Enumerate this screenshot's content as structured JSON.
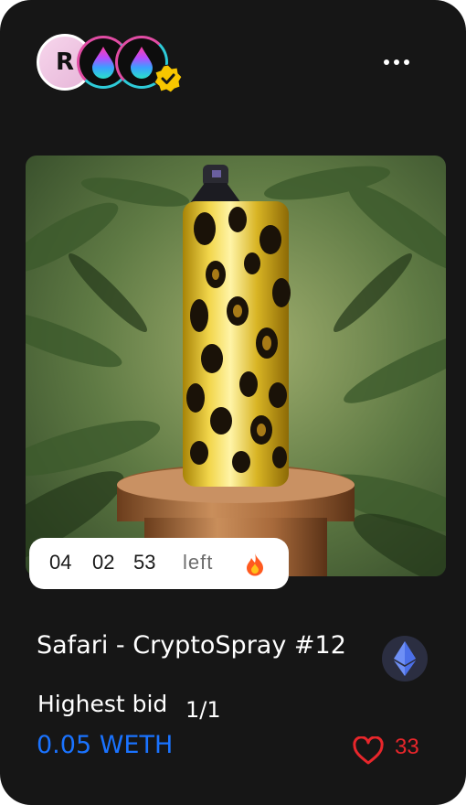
{
  "creators": {
    "avatars": [
      {
        "initial": "R"
      },
      {
        "icon": "rainbow-drop-icon"
      },
      {
        "icon": "rainbow-drop-icon"
      }
    ],
    "verified_icon": "verified-check-icon"
  },
  "menu_icon": "more-horizontal-icon",
  "artwork": {
    "subject": "leopard print spray can on wooden pedestal in jungle"
  },
  "auction": {
    "hours": "04",
    "minutes": "02",
    "seconds": "53",
    "left_label": "left",
    "fire_icon": "fire-icon"
  },
  "item": {
    "title": "Safari - CryptoSpray #12",
    "currency_icon": "ethereum-icon",
    "bid_label": "Highest bid",
    "edition": "1/1",
    "price": "0.05 WETH",
    "likes": "33",
    "like_icon": "heart-icon"
  },
  "colors": {
    "card_bg": "#161616",
    "price": "#1a73ff",
    "likes": "#e8262b",
    "eth_badge": "#2b2e41"
  }
}
